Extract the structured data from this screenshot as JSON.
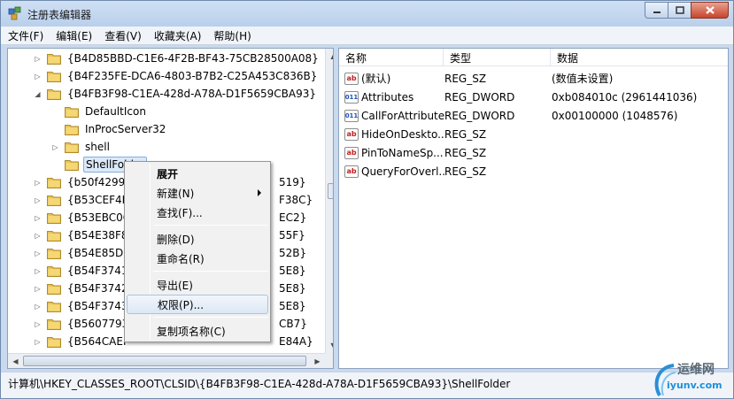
{
  "window": {
    "title": "注册表编辑器"
  },
  "menubar": [
    {
      "label": "文件(F)"
    },
    {
      "label": "编辑(E)"
    },
    {
      "label": "查看(V)"
    },
    {
      "label": "收藏夹(A)"
    },
    {
      "label": "帮助(H)"
    }
  ],
  "tree": [
    {
      "label": "{B4D85BBD-C1E6-4F2B-BF43-75CB28500A08}",
      "indent": 0,
      "expander": "collapsed"
    },
    {
      "label": "{B4F235FE-DCA6-4803-B7B2-C25A453C836B}",
      "indent": 0,
      "expander": "collapsed"
    },
    {
      "label": "{B4FB3F98-C1EA-428d-A78A-D1F5659CBA93}",
      "indent": 0,
      "expander": "expanded"
    },
    {
      "label": "DefaultIcon",
      "indent": 1,
      "expander": "none"
    },
    {
      "label": "InProcServer32",
      "indent": 1,
      "expander": "none"
    },
    {
      "label": "shell",
      "indent": 1,
      "expander": "collapsed"
    },
    {
      "label": "ShellFolder",
      "indent": 1,
      "expander": "none",
      "selected": true
    },
    {
      "label": "{b50f4299-7",
      "suffix": "519}",
      "indent": 0,
      "expander": "collapsed"
    },
    {
      "label": "{B53CEF4B-",
      "suffix": "F38C}",
      "indent": 0,
      "expander": "collapsed"
    },
    {
      "label": "{B53EBC0C-",
      "suffix": "EC2}",
      "indent": 0,
      "expander": "collapsed"
    },
    {
      "label": "{B54E38F8-",
      "suffix": "55F}",
      "indent": 0,
      "expander": "collapsed"
    },
    {
      "label": "{B54E85D9-",
      "suffix": "52B}",
      "indent": 0,
      "expander": "collapsed"
    },
    {
      "label": "{B54F3741-",
      "suffix": "5E8}",
      "indent": 0,
      "expander": "collapsed"
    },
    {
      "label": "{B54F3742-",
      "suffix": "5E8}",
      "indent": 0,
      "expander": "collapsed"
    },
    {
      "label": "{B54F3743-",
      "suffix": "5E8}",
      "indent": 0,
      "expander": "collapsed"
    },
    {
      "label": "{B5607793-",
      "suffix": "CB7}",
      "indent": 0,
      "expander": "collapsed"
    },
    {
      "label": "{B564CAEF-",
      "suffix": "E84A}",
      "indent": 0,
      "expander": "collapsed"
    }
  ],
  "list": {
    "columns": [
      "名称",
      "类型",
      "数据"
    ],
    "rows": [
      {
        "name": "(默认)",
        "type": "REG_SZ",
        "data": "(数值未设置)",
        "icon": "sz"
      },
      {
        "name": "Attributes",
        "type": "REG_DWORD",
        "data": "0xb084010c (2961441036)",
        "icon": "dword"
      },
      {
        "name": "CallForAttributes",
        "type": "REG_DWORD",
        "data": "0x00100000 (1048576)",
        "icon": "dword"
      },
      {
        "name": "HideOnDeskto...",
        "type": "REG_SZ",
        "data": "",
        "icon": "sz"
      },
      {
        "name": "PinToNameSp...",
        "type": "REG_SZ",
        "data": "",
        "icon": "sz"
      },
      {
        "name": "QueryForOverl...",
        "type": "REG_SZ",
        "data": "",
        "icon": "sz"
      }
    ]
  },
  "context_menu": [
    {
      "label": "展开",
      "bold": true
    },
    {
      "label": "新建(N)",
      "submenu": true
    },
    {
      "label": "查找(F)..."
    },
    {
      "separator": true
    },
    {
      "label": "删除(D)"
    },
    {
      "label": "重命名(R)"
    },
    {
      "separator": true
    },
    {
      "label": "导出(E)"
    },
    {
      "label": "权限(P)...",
      "highlighted": true
    },
    {
      "separator": true
    },
    {
      "label": "复制项名称(C)"
    }
  ],
  "statusbar": {
    "path": "计算机\\HKEY_CLASSES_ROOT\\CLSID\\{B4FB3F98-C1EA-428d-A78A-D1F5659CBA93}\\ShellFolder"
  },
  "watermark": {
    "cn": "运维网",
    "url": "iyunv.com"
  },
  "colors": {
    "folder": "#e8c25a",
    "selection": "#dbe9f8",
    "accent": "#84acdd"
  }
}
